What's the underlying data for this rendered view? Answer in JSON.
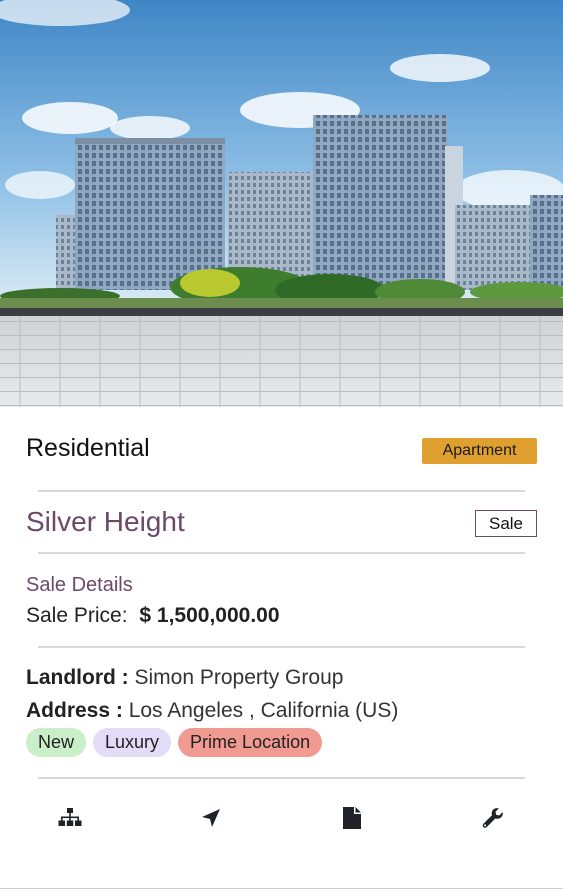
{
  "listing": {
    "category": "Residential",
    "type_badge": "Apartment",
    "name": "Silver Height",
    "status_badge": "Sale",
    "sale_heading": "Sale Details",
    "sale_price_label": "Sale Price:",
    "sale_price_value": "$ 1,500,000.00",
    "landlord_label": "Landlord :",
    "landlord_value": "Simon Property Group",
    "address_label": "Address :",
    "address_value": "Los Angeles , California (US)",
    "tags": [
      {
        "label": "New",
        "color": "#c9eec8"
      },
      {
        "label": "Luxury",
        "color": "#e3dcf8"
      },
      {
        "label": "Prime Location",
        "color": "#f09a92"
      }
    ]
  },
  "actions": [
    {
      "icon": "sitemap-icon"
    },
    {
      "icon": "location-arrow-icon"
    },
    {
      "icon": "document-icon"
    },
    {
      "icon": "wrench-icon"
    }
  ],
  "colors": {
    "accent": "#6b4a68",
    "type_badge": "#e0a030"
  }
}
